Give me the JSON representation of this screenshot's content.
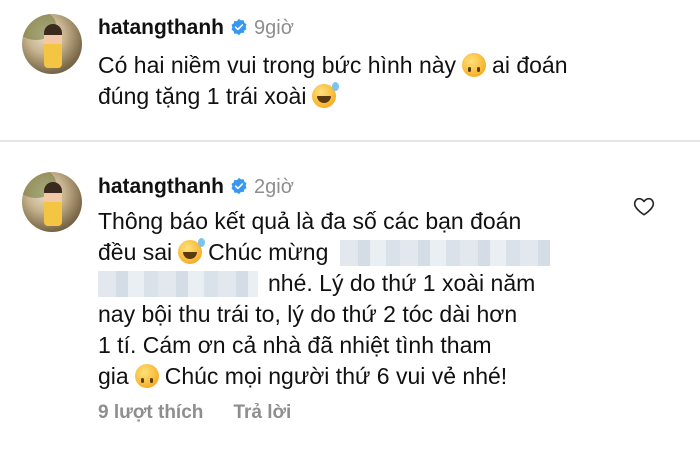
{
  "comments": [
    {
      "username": "hatangthanh",
      "time": "9giờ",
      "line1_a": "Có hai niềm vui trong bức hình này",
      "line1_b": "ai đoán",
      "line2": "đúng tặng 1 trái xoài"
    },
    {
      "username": "hatangthanh",
      "time": "2giờ",
      "line1": "Thông báo kết quả là đa số các bạn đoán",
      "line2_a": "đều sai",
      "line2_b": "Chúc mừng",
      "line3": "nhé. Lý do thứ 1 xoài năm",
      "line4": "nay bội thu trái to, lý do thứ 2 tóc dài hơn",
      "line5": "1 tí.  Cám ơn cả nhà đã nhiệt tình tham",
      "line6_a": "gia",
      "line6_b": "Chúc mọi người thứ 6 vui vẻ nhé!",
      "likes": "9 lượt thích",
      "reply": "Trả lời"
    }
  ],
  "icons": {
    "verified": "verified-badge-icon",
    "emoji_upside": "upside-down-face-emoji",
    "emoji_sweat": "grinning-sweat-emoji",
    "like": "heart-outline-icon"
  },
  "colors": {
    "verified_blue": "#3897f0",
    "meta_gray": "#8e8e8e",
    "text": "#111111"
  }
}
